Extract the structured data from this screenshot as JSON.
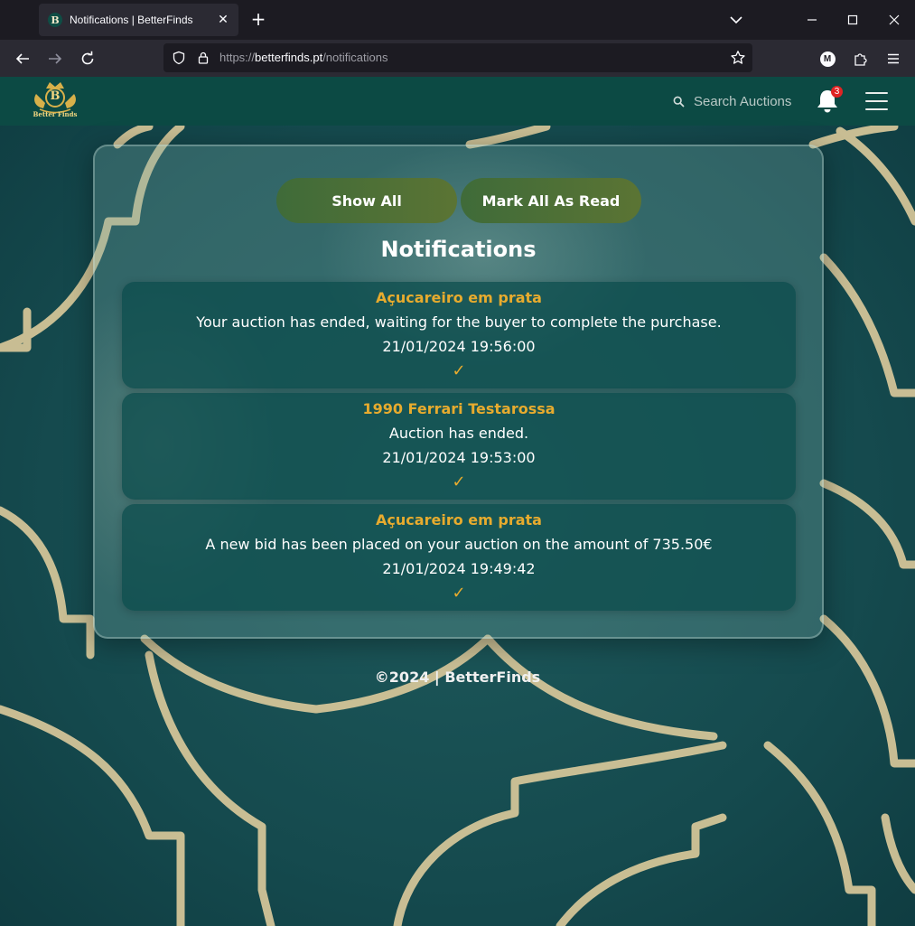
{
  "browser": {
    "tab_title": "Notifications | BetterFinds",
    "tab_favicon_letter": "B",
    "url_prefix": "https://",
    "url_host": "betterfinds.pt",
    "url_path": "/notifications",
    "profile_letter": "M"
  },
  "header": {
    "logo_letter": "B",
    "logo_text": "Better Finds",
    "search_placeholder": "Search Auctions",
    "notification_count": "3"
  },
  "panel": {
    "show_all_label": "Show All",
    "mark_all_read_label": "Mark All As Read",
    "title": "Notifications"
  },
  "notifications": [
    {
      "title": "Açucareiro em prata",
      "message": "Your auction has ended, waiting for the buyer to complete the purchase.",
      "date": "21/01/2024 19:56:00",
      "check": "✓"
    },
    {
      "title": "1990 Ferrari Testarossa",
      "message": "Auction has ended.",
      "date": "21/01/2024 19:53:00",
      "check": "✓"
    },
    {
      "title": "Açucareiro em prata",
      "message": "A new bid has been placed on your auction on the amount of 735.50€",
      "date": "21/01/2024 19:49:42",
      "check": "✓"
    }
  ],
  "footer": {
    "text": "©2024 | BetterFinds"
  },
  "colors": {
    "accent_gold": "#e7ab2e",
    "header_teal": "#0c4a44",
    "button_green": "#4a6f37",
    "badge_red": "#e02424"
  }
}
